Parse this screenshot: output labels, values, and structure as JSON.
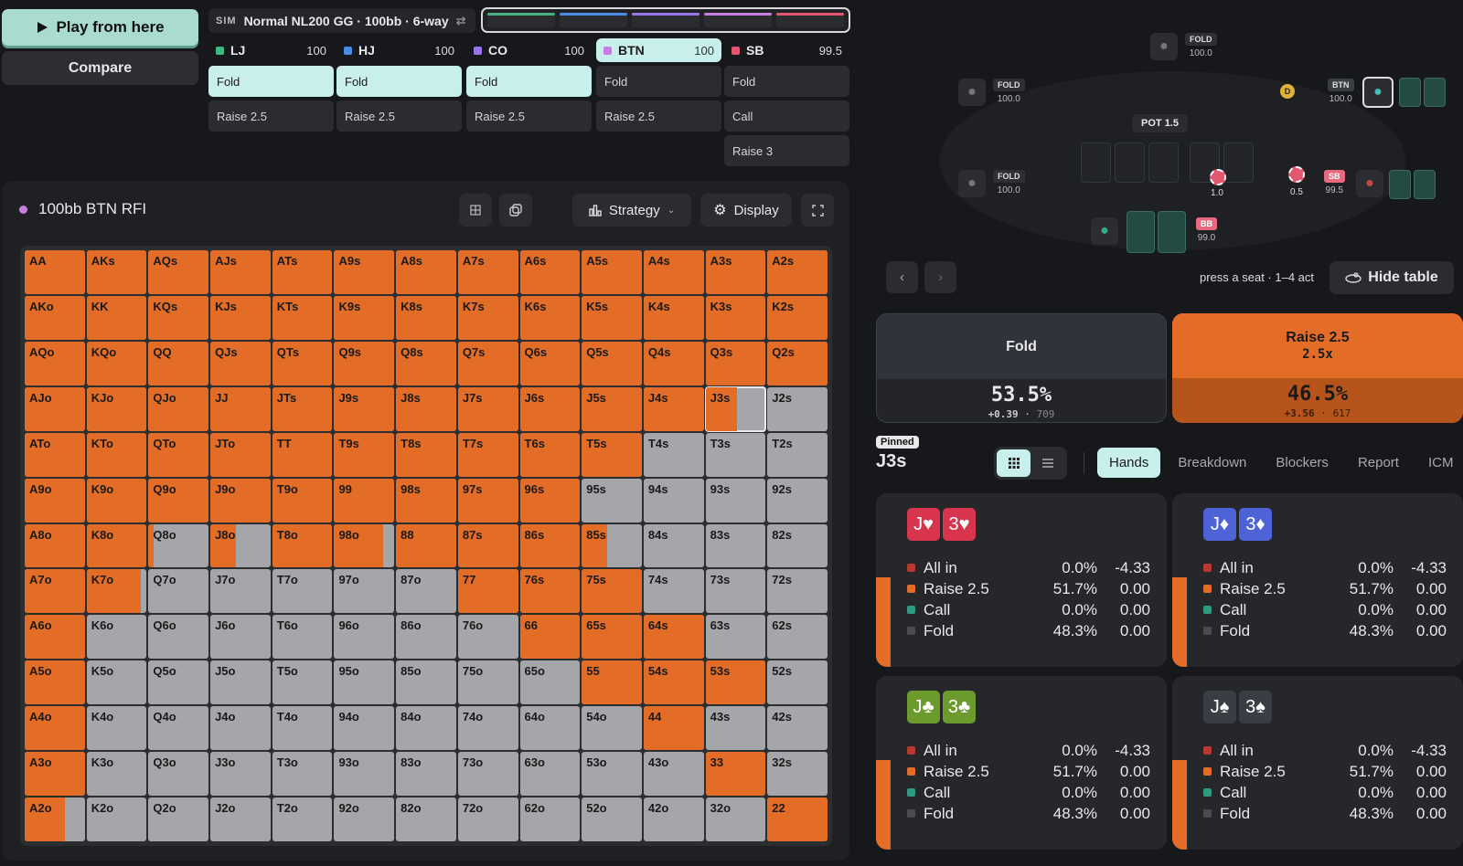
{
  "controls": {
    "play_label": "Play from here",
    "compare_label": "Compare"
  },
  "sim": {
    "tag": "SIM",
    "title": "Normal NL200 GG · 100bb · 6-way"
  },
  "track_colors": [
    "#46b07e",
    "#4a8be8",
    "#9a74ea",
    "#c67ee0",
    "#e2566f"
  ],
  "seats": [
    {
      "name": "LJ",
      "stack": "100",
      "color": "#40b683",
      "actions": [
        {
          "label": "Fold",
          "selected": true
        },
        {
          "label": "Raise 2.5",
          "selected": false
        }
      ]
    },
    {
      "name": "HJ",
      "stack": "100",
      "color": "#4a8be8",
      "actions": [
        {
          "label": "Fold",
          "selected": true
        },
        {
          "label": "Raise 2.5",
          "selected": false
        }
      ]
    },
    {
      "name": "CO",
      "stack": "100",
      "color": "#9a74ea",
      "actions": [
        {
          "label": "Fold",
          "selected": true
        },
        {
          "label": "Raise 2.5",
          "selected": false
        }
      ]
    },
    {
      "name": "BTN",
      "stack": "100",
      "color": "#c67ee0",
      "actions": [
        {
          "label": "Fold",
          "selected": false
        },
        {
          "label": "Raise 2.5",
          "selected": false
        }
      ],
      "active": true
    },
    {
      "name": "SB",
      "stack": "99.5",
      "color": "#e2566f",
      "actions": [
        {
          "label": "Fold",
          "selected": false
        },
        {
          "label": "Call",
          "selected": false
        },
        {
          "label": "Raise 3",
          "selected": false
        }
      ]
    }
  ],
  "panel": {
    "title": "100bb BTN RFI",
    "strategy_label": "Strategy",
    "display_label": "Display"
  },
  "grid": {
    "ranks": [
      "A",
      "K",
      "Q",
      "J",
      "T",
      "9",
      "8",
      "7",
      "6",
      "5",
      "4",
      "3",
      "2"
    ],
    "raise_frac": [
      [
        1,
        1,
        1,
        1,
        1,
        1,
        1,
        1,
        1,
        1,
        1,
        1,
        1
      ],
      [
        1,
        1,
        1,
        1,
        1,
        1,
        1,
        1,
        1,
        1,
        1,
        1,
        1
      ],
      [
        1,
        1,
        1,
        1,
        1,
        1,
        1,
        1,
        1,
        1,
        1,
        1,
        1
      ],
      [
        1,
        1,
        1,
        1,
        1,
        1,
        1,
        1,
        1,
        1,
        1,
        0.517,
        0
      ],
      [
        1,
        1,
        1,
        1,
        1,
        1,
        1,
        1,
        1,
        1,
        0,
        0,
        0
      ],
      [
        1,
        1,
        1,
        1,
        1,
        1,
        1,
        1,
        1,
        0,
        0,
        0,
        0
      ],
      [
        1,
        1,
        0.08,
        0.42,
        1,
        0.82,
        1,
        1,
        1,
        0.42,
        0,
        0,
        0
      ],
      [
        1,
        0.9,
        0,
        0,
        0,
        0,
        0,
        1,
        1,
        1,
        0,
        0,
        0
      ],
      [
        1,
        0,
        0,
        0,
        0,
        0,
        0,
        0,
        1,
        1,
        1,
        0,
        0
      ],
      [
        1,
        0,
        0,
        0,
        0,
        0,
        0,
        0,
        0,
        1,
        1,
        1,
        0
      ],
      [
        1,
        0,
        0,
        0,
        0,
        0,
        0,
        0,
        0,
        0,
        1,
        0,
        0
      ],
      [
        1,
        0,
        0,
        0,
        0,
        0,
        0,
        0,
        0,
        0,
        0,
        1,
        0
      ],
      [
        0.67,
        0,
        0,
        0,
        0,
        0,
        0,
        0,
        0,
        0,
        0,
        0,
        1
      ]
    ],
    "pinned_cell": "J3s"
  },
  "table": {
    "pot_label": "POT",
    "pot_value": "1.5",
    "players": [
      {
        "pos": "FOLD",
        "stack": "100.0"
      },
      {
        "pos": "FOLD",
        "stack": "100.0"
      },
      {
        "pos": "FOLD",
        "stack": "100.0"
      },
      {
        "pos": "BTN",
        "stack": "100.0"
      },
      {
        "pos": "SB",
        "stack": "99.5"
      },
      {
        "pos": "BB",
        "stack": "99.0"
      }
    ],
    "bets": [
      "1.0",
      "0.5"
    ],
    "dealer": "D",
    "hint": "press a seat · 1–4 act",
    "hide_label": "Hide table"
  },
  "options": [
    {
      "name": "Fold",
      "size": "",
      "pct": "53.5%",
      "ev": "+0.39",
      "combos": "709"
    },
    {
      "name": "Raise 2.5",
      "size": "2.5x",
      "pct": "46.5%",
      "ev": "+3.56",
      "combos": "617"
    }
  ],
  "pinned": {
    "badge": "Pinned",
    "hand": "J3s"
  },
  "tabs": [
    "Hands",
    "Breakdown",
    "Blockers",
    "Report",
    "ICM"
  ],
  "combos": [
    {
      "c1": "J♥",
      "c2": "3♥",
      "color": "#d9344d",
      "rows": [
        {
          "n": "All in",
          "p": "0.0%",
          "e": "-4.33"
        },
        {
          "n": "Raise 2.5",
          "p": "51.7%",
          "e": "0.00"
        },
        {
          "n": "Call",
          "p": "0.0%",
          "e": "0.00"
        },
        {
          "n": "Fold",
          "p": "48.3%",
          "e": "0.00"
        }
      ]
    },
    {
      "c1": "J♦",
      "c2": "3♦",
      "color": "#4d63d6",
      "rows": [
        {
          "n": "All in",
          "p": "0.0%",
          "e": "-4.33"
        },
        {
          "n": "Raise 2.5",
          "p": "51.7%",
          "e": "0.00"
        },
        {
          "n": "Call",
          "p": "0.0%",
          "e": "0.00"
        },
        {
          "n": "Fold",
          "p": "48.3%",
          "e": "0.00"
        }
      ]
    },
    {
      "c1": "J♣",
      "c2": "3♣",
      "color": "#6c9a2c",
      "rows": [
        {
          "n": "All in",
          "p": "0.0%",
          "e": "-4.33"
        },
        {
          "n": "Raise 2.5",
          "p": "51.7%",
          "e": "0.00"
        },
        {
          "n": "Call",
          "p": "0.0%",
          "e": "0.00"
        },
        {
          "n": "Fold",
          "p": "48.3%",
          "e": "0.00"
        }
      ]
    },
    {
      "c1": "J♠",
      "c2": "3♠",
      "color": "#3a3d44",
      "rows": [
        {
          "n": "All in",
          "p": "0.0%",
          "e": "-4.33"
        },
        {
          "n": "Raise 2.5",
          "p": "51.7%",
          "e": "0.00"
        },
        {
          "n": "Call",
          "p": "0.0%",
          "e": "0.00"
        },
        {
          "n": "Fold",
          "p": "48.3%",
          "e": "0.00"
        }
      ]
    }
  ],
  "combo_colors": {
    "All in": "#b83a2c",
    "Raise 2.5": "#e36d26",
    "Call": "#2f9a80",
    "Fold": "#4a4c52"
  },
  "combo_raise_frac": 0.517
}
